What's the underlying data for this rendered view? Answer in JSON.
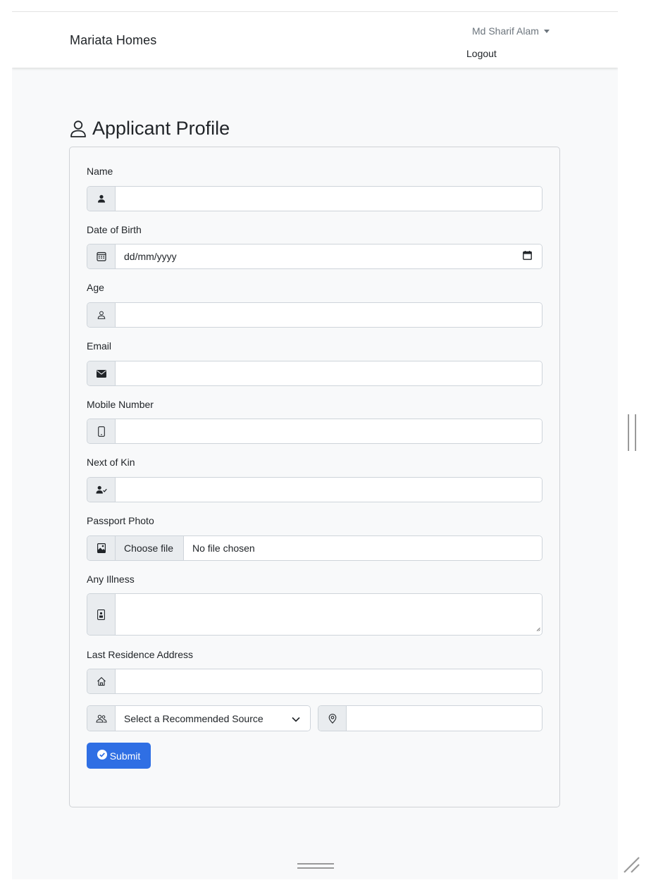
{
  "navbar": {
    "brand": "Mariata Homes",
    "user_name": "Md Sharif Alam",
    "logout": "Logout"
  },
  "page": {
    "title": "Applicant Profile"
  },
  "form": {
    "name_label": "Name",
    "dob_label": "Date of Birth",
    "dob_placeholder": "dd/mm/yyyy",
    "age_label": "Age",
    "email_label": "Email",
    "mobile_label": "Mobile Number",
    "kin_label": "Next of Kin",
    "photo_label": "Passport Photo",
    "photo_button": "Choose file",
    "photo_status": "No file chosen",
    "illness_label": "Any Illness",
    "address_label": "Last Residence Address",
    "source_select": "Select a Recommended Source",
    "submit_label": "Submit"
  },
  "icons": {
    "name": "person-fill-icon",
    "dob": "calendar-icon",
    "age": "person-icon",
    "email": "envelope-icon",
    "mobile": "phone-icon",
    "kin": "person-check-icon",
    "photo": "image-icon",
    "illness": "medical-file-icon",
    "address": "house-icon",
    "source": "people-icon",
    "location": "geo-pin-icon",
    "submit": "check-circle-icon"
  },
  "colors": {
    "primary": "#2f6fe4",
    "addon_bg": "#e9ecef",
    "border": "#ced4da",
    "background": "#f8f9fa"
  }
}
